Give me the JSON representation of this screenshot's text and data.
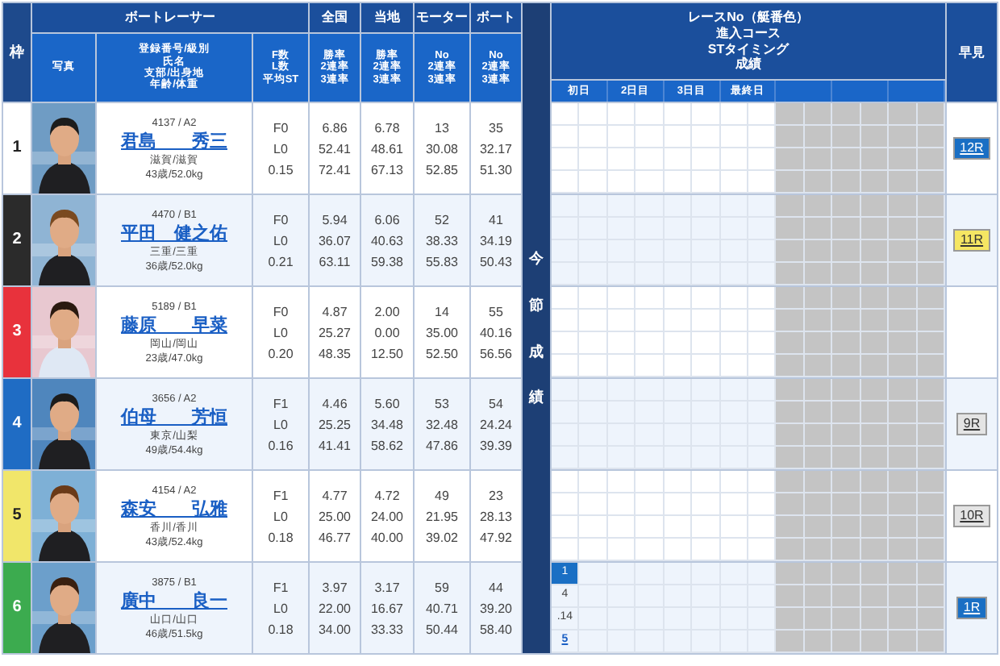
{
  "header": {
    "frame": "枠",
    "group_title": "ボートレーサー",
    "photo": "写真",
    "racer_info": [
      "登録番号/級別",
      "氏名",
      "支部/出身地",
      "年齢/体重"
    ],
    "fl": [
      "F数",
      "L数",
      "平均ST"
    ],
    "stats": [
      {
        "title": "全国",
        "lines": [
          "勝率",
          "2連率",
          "3連率"
        ]
      },
      {
        "title": "当地",
        "lines": [
          "勝率",
          "2連率",
          "3連率"
        ]
      },
      {
        "title": "モーター",
        "lines": [
          "No",
          "2連率",
          "3連率"
        ]
      },
      {
        "title": "ボート",
        "lines": [
          "No",
          "2連率",
          "3連率"
        ]
      }
    ],
    "side_label": "今節成績",
    "results_title": [
      "レースNo（艇番色）",
      "進入コース",
      "STタイミング",
      "成績"
    ],
    "days": [
      "初日",
      "2日目",
      "3日目",
      "最終日"
    ],
    "quick": "早見"
  },
  "racers": [
    {
      "frame": "1",
      "color": "#ffffff",
      "id_class": "4137 / A2",
      "name": "君島　　秀三",
      "branch": "滋賀/滋賀",
      "age_weight": "43歳/52.0kg",
      "f": "F0",
      "l": "L0",
      "st": "0.15",
      "stats": [
        [
          "6.86",
          "52.41",
          "72.41"
        ],
        [
          "6.78",
          "48.61",
          "67.13"
        ],
        [
          "13",
          "30.08",
          "52.85"
        ],
        [
          "35",
          "32.17",
          "51.30"
        ]
      ],
      "quick": {
        "label": "12R",
        "color": "#1a6fc4"
      }
    },
    {
      "frame": "2",
      "color": "#2b2b2b",
      "id_class": "4470 / B1",
      "name": "平田　健之佑",
      "branch": "三重/三重",
      "age_weight": "36歳/52.0kg",
      "f": "F0",
      "l": "L0",
      "st": "0.21",
      "stats": [
        [
          "5.94",
          "36.07",
          "63.11"
        ],
        [
          "6.06",
          "40.63",
          "59.38"
        ],
        [
          "52",
          "38.33",
          "55.83"
        ],
        [
          "41",
          "34.19",
          "50.43"
        ]
      ],
      "quick": {
        "label": "11R",
        "color": "#f5e663"
      }
    },
    {
      "frame": "3",
      "color": "#e8323c",
      "id_class": "5189 / B1",
      "name": "藤原　　早菜",
      "branch": "岡山/岡山",
      "age_weight": "23歳/47.0kg",
      "f": "F0",
      "l": "L0",
      "st": "0.20",
      "stats": [
        [
          "4.87",
          "25.27",
          "48.35"
        ],
        [
          "2.00",
          "0.00",
          "12.50"
        ],
        [
          "14",
          "35.00",
          "52.50"
        ],
        [
          "55",
          "40.16",
          "56.56"
        ]
      ]
    },
    {
      "frame": "4",
      "color": "#1f6cc4",
      "id_class": "3656 / A2",
      "name": "伯母　　芳恒",
      "branch": "東京/山梨",
      "age_weight": "49歳/54.4kg",
      "f": "F1",
      "l": "L0",
      "st": "0.16",
      "stats": [
        [
          "4.46",
          "25.25",
          "41.41"
        ],
        [
          "5.60",
          "34.48",
          "58.62"
        ],
        [
          "53",
          "32.48",
          "47.86"
        ],
        [
          "54",
          "24.24",
          "39.39"
        ]
      ],
      "quick": {
        "label": "9R",
        "color": "#e4e4e4"
      }
    },
    {
      "frame": "5",
      "color": "#f1e66a",
      "id_class": "4154 / A2",
      "name": "森安　　弘雅",
      "branch": "香川/香川",
      "age_weight": "43歳/52.4kg",
      "f": "F1",
      "l": "L0",
      "st": "0.18",
      "stats": [
        [
          "4.77",
          "25.00",
          "46.77"
        ],
        [
          "4.72",
          "24.00",
          "40.00"
        ],
        [
          "49",
          "21.95",
          "39.02"
        ],
        [
          "23",
          "28.13",
          "47.92"
        ]
      ],
      "quick": {
        "label": "10R",
        "color": "#e4e4e4"
      }
    },
    {
      "frame": "6",
      "color": "#3cab4f",
      "id_class": "3875 / B1",
      "name": "廣中　　良一",
      "branch": "山口/山口",
      "age_weight": "46歳/51.5kg",
      "f": "F1",
      "l": "L0",
      "st": "0.18",
      "stats": [
        [
          "3.97",
          "22.00",
          "34.00"
        ],
        [
          "3.17",
          "16.67",
          "33.33"
        ],
        [
          "59",
          "40.71",
          "50.44"
        ],
        [
          "44",
          "39.20",
          "58.40"
        ]
      ],
      "results": [
        {
          "race": "1",
          "color": "#1a6fc4",
          "course": "4",
          "st": ".14",
          "place": "5"
        }
      ],
      "quick": {
        "label": "1R",
        "color": "#1a6fc4"
      }
    }
  ]
}
